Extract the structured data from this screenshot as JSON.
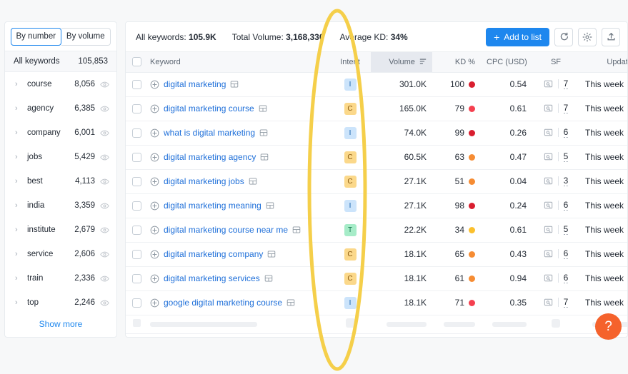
{
  "sidebar": {
    "toggle": {
      "by_number": "By number",
      "by_volume": "By volume",
      "active": "By number"
    },
    "all_keywords": {
      "label": "All keywords",
      "count": "105,853"
    },
    "items": [
      {
        "label": "course",
        "count": "8,056"
      },
      {
        "label": "agency",
        "count": "6,385"
      },
      {
        "label": "company",
        "count": "6,001"
      },
      {
        "label": "jobs",
        "count": "5,429"
      },
      {
        "label": "best",
        "count": "4,113"
      },
      {
        "label": "india",
        "count": "3,359"
      },
      {
        "label": "institute",
        "count": "2,679"
      },
      {
        "label": "service",
        "count": "2,606"
      },
      {
        "label": "train",
        "count": "2,336"
      },
      {
        "label": "top",
        "count": "2,246"
      }
    ],
    "show_more": "Show more"
  },
  "toolbar": {
    "all_keywords_label": "All keywords:",
    "all_keywords_value": "105.9K",
    "total_volume_label": "Total Volume:",
    "total_volume_value": "3,168,330",
    "average_kd_label": "Average KD:",
    "average_kd_value": "34%",
    "add_to_list": "Add to list",
    "plus": "+"
  },
  "table": {
    "headers": {
      "keyword": "Keyword",
      "intent": "Intent",
      "volume": "Volume",
      "kd": "KD %",
      "cpc": "CPC (USD)",
      "sf": "SF",
      "updated": "Updated"
    },
    "rows": [
      {
        "keyword": "digital marketing",
        "intent": "I",
        "volume": "301.0K",
        "kd": "100",
        "kd_color": "#d91e2f",
        "cpc": "0.54",
        "sf": "7",
        "updated": "This week"
      },
      {
        "keyword": "digital marketing course",
        "intent": "C",
        "volume": "165.0K",
        "kd": "79",
        "kd_color": "#f5404f",
        "cpc": "0.61",
        "sf": "7",
        "updated": "This week"
      },
      {
        "keyword": "what is digital marketing",
        "intent": "I",
        "volume": "74.0K",
        "kd": "99",
        "kd_color": "#d91e2f",
        "cpc": "0.26",
        "sf": "6",
        "updated": "This week"
      },
      {
        "keyword": "digital marketing agency",
        "intent": "C",
        "volume": "60.5K",
        "kd": "63",
        "kd_color": "#f68c33",
        "cpc": "0.47",
        "sf": "5",
        "updated": "This week"
      },
      {
        "keyword": "digital marketing jobs",
        "intent": "C",
        "volume": "27.1K",
        "kd": "51",
        "kd_color": "#f68c33",
        "cpc": "0.04",
        "sf": "3",
        "updated": "This week"
      },
      {
        "keyword": "digital marketing meaning",
        "intent": "I",
        "volume": "27.1K",
        "kd": "98",
        "kd_color": "#d91e2f",
        "cpc": "0.24",
        "sf": "6",
        "updated": "This week"
      },
      {
        "keyword": "digital marketing course near me",
        "intent": "T",
        "volume": "22.2K",
        "kd": "34",
        "kd_color": "#fbc02d",
        "cpc": "0.61",
        "sf": "5",
        "updated": "This week"
      },
      {
        "keyword": "digital marketing company",
        "intent": "C",
        "volume": "18.1K",
        "kd": "65",
        "kd_color": "#f68c33",
        "cpc": "0.43",
        "sf": "6",
        "updated": "This week"
      },
      {
        "keyword": "digital marketing services",
        "intent": "C",
        "volume": "18.1K",
        "kd": "61",
        "kd_color": "#f68c33",
        "cpc": "0.94",
        "sf": "6",
        "updated": "This week"
      },
      {
        "keyword": "google digital marketing course",
        "intent": "I",
        "volume": "18.1K",
        "kd": "71",
        "kd_color": "#f5404f",
        "cpc": "0.35",
        "sf": "7",
        "updated": "This week"
      }
    ]
  },
  "help": {
    "label": "?"
  },
  "colors": {
    "accent": "#1e87ee",
    "annotation": "#f5cf4a",
    "help_fab": "#f5622c"
  }
}
